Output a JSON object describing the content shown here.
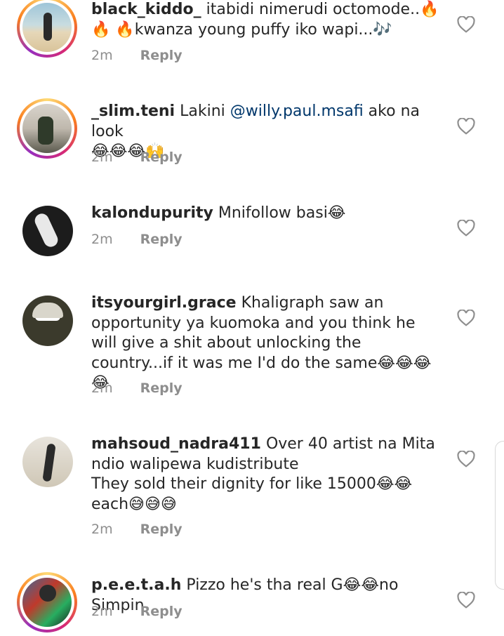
{
  "comments": [
    {
      "username": "black_kiddo_",
      "text": "itabidi nimerudi octomode..🔥\n🔥 🔥kwanza young puffy iko wapi...🎶",
      "time": "2m",
      "reply": "Reply"
    },
    {
      "username": "_slim.teni",
      "text_before": "Lakini ",
      "mention": "@willy.paul.msafi",
      "text_after": " ako na look\n😂😂😂🙌",
      "time": "2m",
      "reply": "Reply"
    },
    {
      "username": "kalondupurity",
      "text": "Mnifollow basi😂",
      "time": "2m",
      "reply": "Reply"
    },
    {
      "username": "itsyourgirl.grace",
      "text": "Khaligraph saw an opportunity ya kuomoka and you think he will give a shit about unlocking the country...if it was me I'd do the same😂😂😂😂",
      "time": "2m",
      "reply": "Reply"
    },
    {
      "username": "mahsoud_nadra411",
      "text": "Over 40 artist na Mita ndio walipewa kudistribute\nThey sold their dignity for like 15000😂😂\neach😅😅😅",
      "time": "2m",
      "reply": "Reply"
    },
    {
      "username": "p.e.e.t.a.h",
      "text": "Pizzo he's tha real G😂😂no Simpin",
      "time": "2m",
      "reply": "Reply"
    }
  ],
  "icons": {
    "like": "heart-outline-icon"
  }
}
